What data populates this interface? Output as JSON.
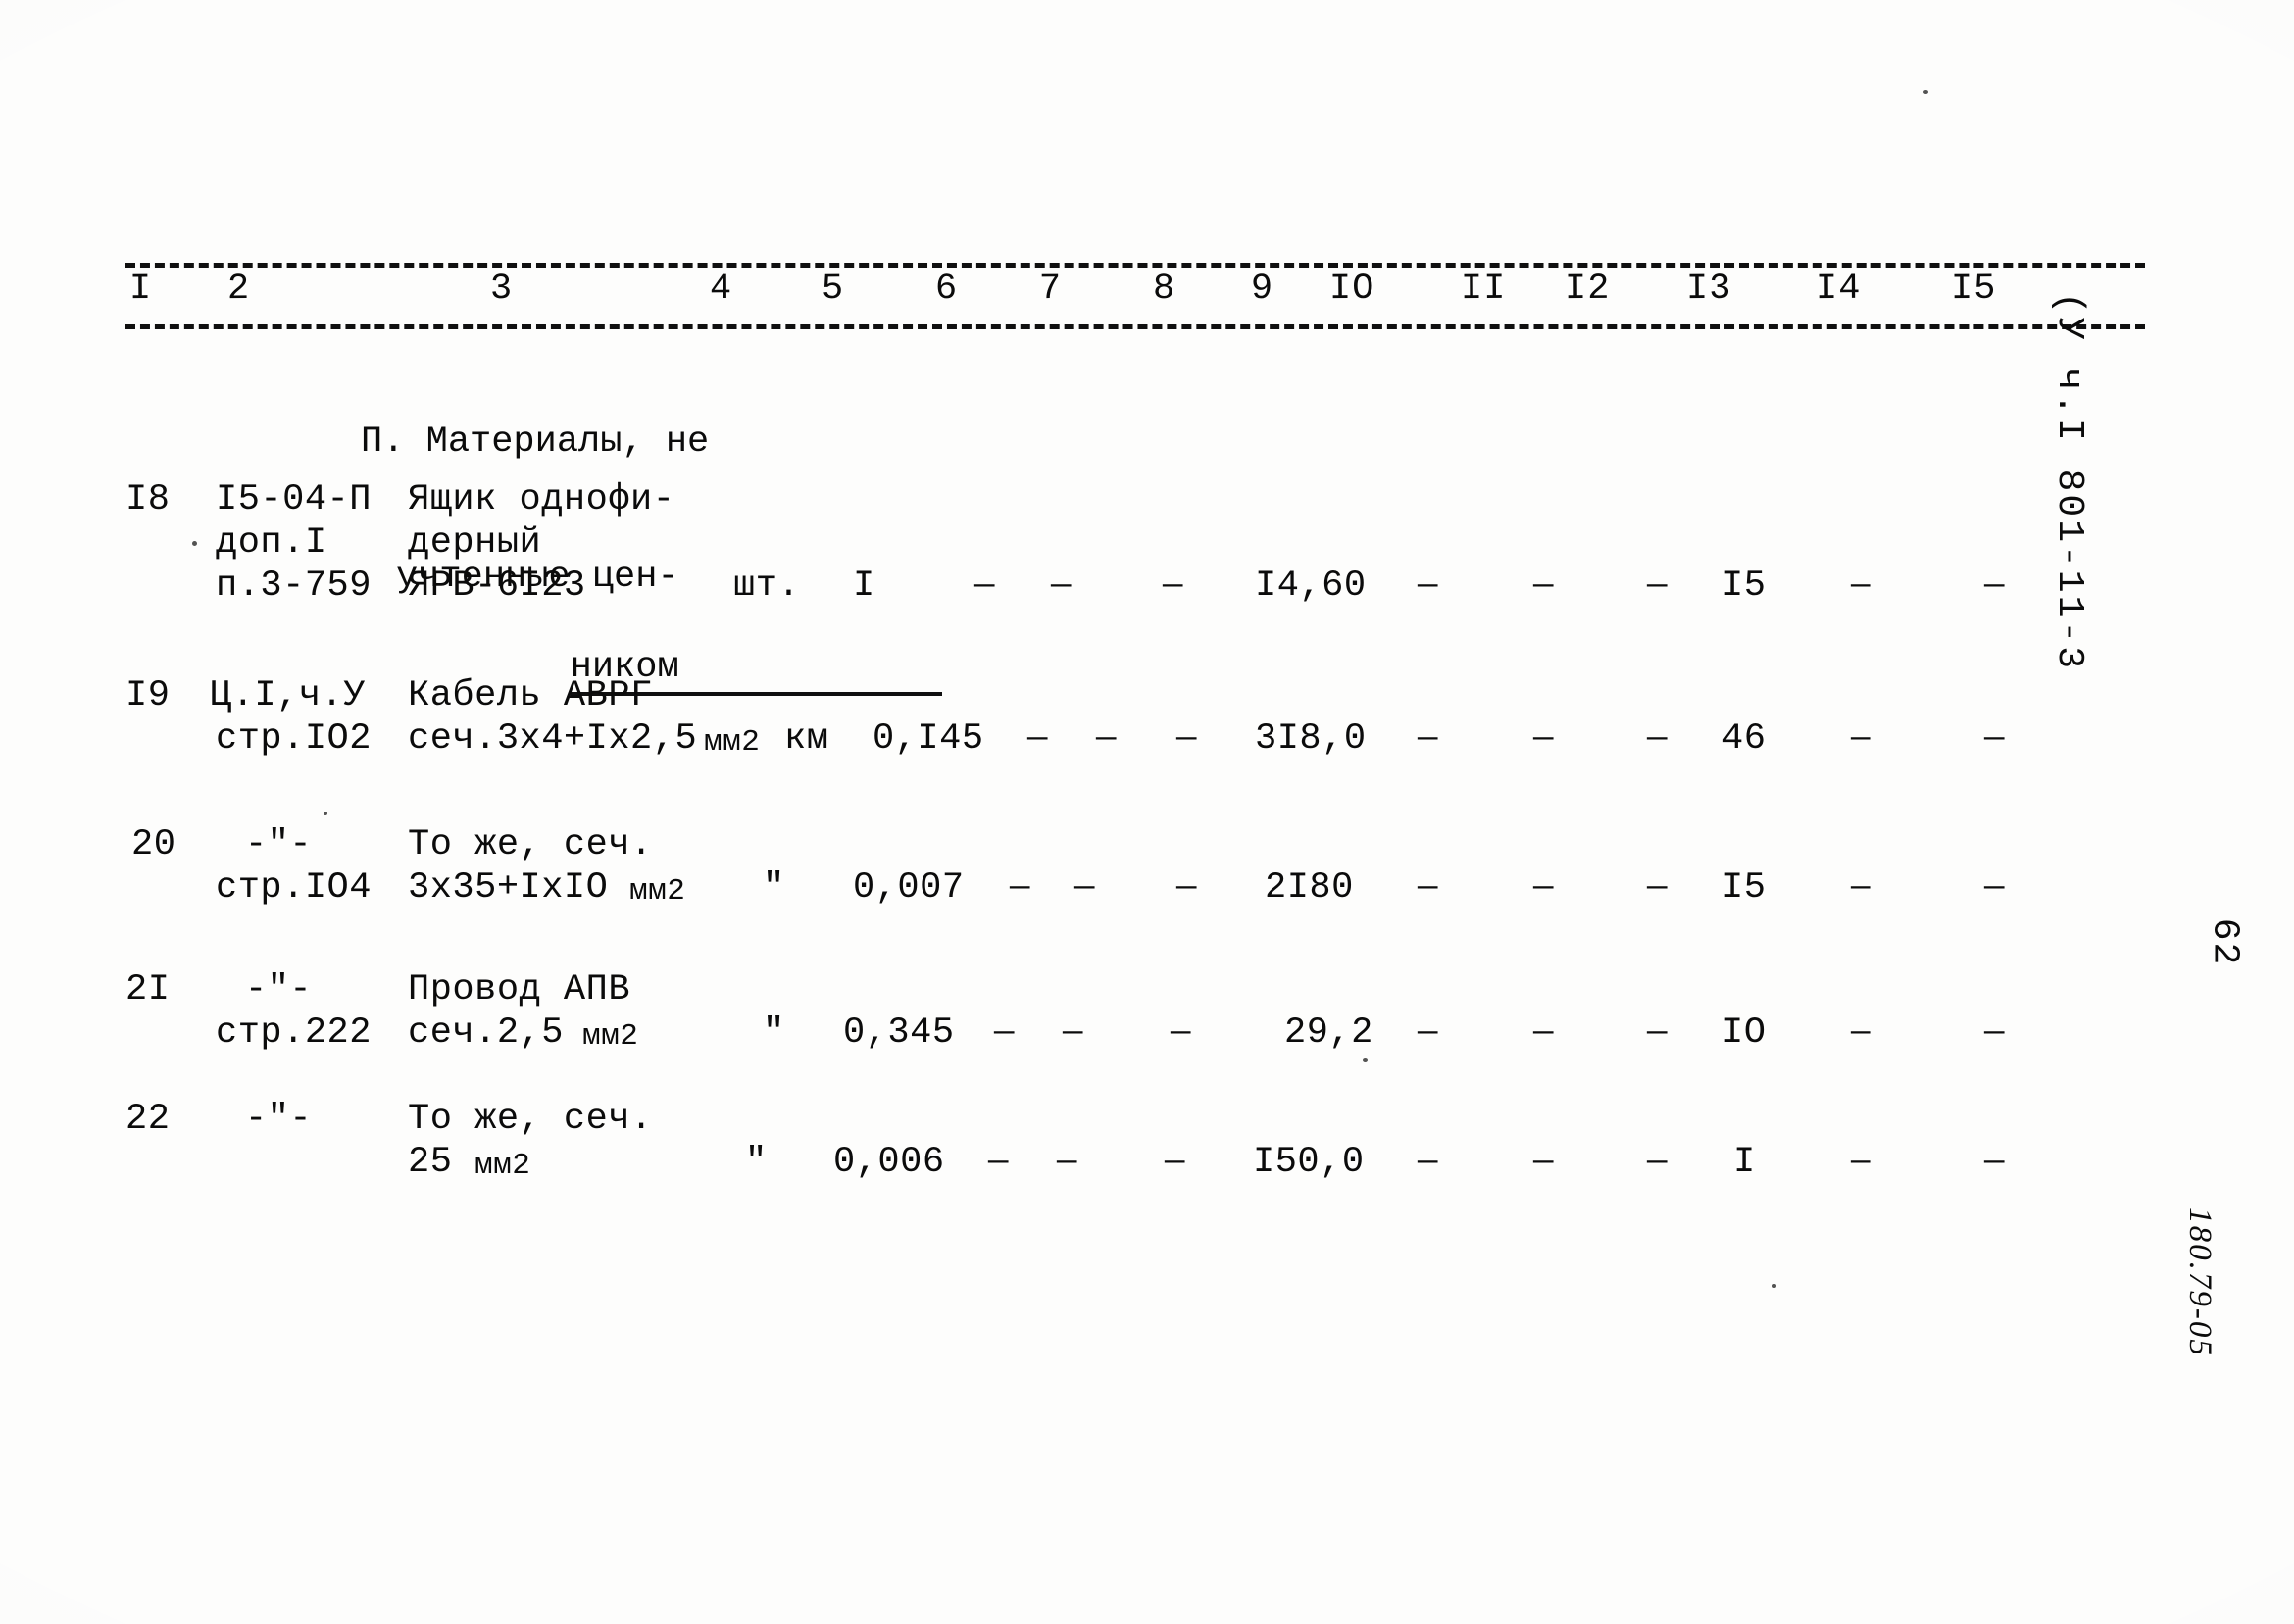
{
  "document": {
    "type": "scanned-estimate-table",
    "ink_color": "#0b0b0b",
    "paper_color": "#fdfdfc"
  },
  "column_headers": [
    "I",
    "2",
    "3",
    "4",
    "5",
    "6",
    "7",
    "8",
    "9",
    "IO",
    "II",
    "I2",
    "I3",
    "I4",
    "I5"
  ],
  "section": {
    "line1": "П. Материалы, не",
    "line2": "учтенные цен-",
    "line3": "ником"
  },
  "rows": [
    {
      "num": "I8",
      "code_line1": "I5-04-П",
      "code_line2": "доп.I",
      "code_line3": "п.3-759",
      "name_line1": "Ящик однофи-",
      "name_line2": "дерный",
      "name_line3": "ЯРВ-6I23",
      "unit": "шт.",
      "qty": "I",
      "c6": "—",
      "c7": "—",
      "c8": "—",
      "price": "I4,60",
      "c10": "—",
      "c11": "—",
      "c12": "—",
      "c13": "I5",
      "c14": "—",
      "c15": "—"
    },
    {
      "num": "I9",
      "code_line1": "Ц.I,ч.У",
      "code_line2": "стр.IO2",
      "code_line3": "",
      "name_line1": "Кабель АВРГ",
      "name_line2": "сеч.3х4+Iх2,5",
      "name_line2_sub": "мм2",
      "name_line3": "",
      "unit": "км",
      "qty": "0,I45",
      "c6": "—",
      "c7": "—",
      "c8": "—",
      "price": "3I8,0",
      "c10": "—",
      "c11": "—",
      "c12": "—",
      "c13": "46",
      "c14": "—",
      "c15": "—"
    },
    {
      "num": "20",
      "code_line1": "-\"-",
      "code_line2": "стр.IO4",
      "code_line3": "",
      "name_line1": "То же, сеч.",
      "name_line2": "3х35+IхIO",
      "name_line2_sub": "мм2",
      "name_line3": "",
      "unit": "\"",
      "qty": "0,007",
      "c6": "—",
      "c7": "—",
      "c8": "—",
      "price": "2I80",
      "c10": "—",
      "c11": "—",
      "c12": "—",
      "c13": "I5",
      "c14": "—",
      "c15": "—"
    },
    {
      "num": "2I",
      "code_line1": "-\"-",
      "code_line2": "стр.222",
      "code_line3": "",
      "name_line1": "Провод АПВ",
      "name_line2": "сеч.2,5",
      "name_line2_sub": "мм2",
      "name_line3": "",
      "unit": "\"",
      "qty": "0,345",
      "c6": "—",
      "c7": "—",
      "c8": "—",
      "price": "29,2",
      "c10": "—",
      "c11": "—",
      "c12": "—",
      "c13": "IO",
      "c14": "—",
      "c15": "—"
    },
    {
      "num": "22",
      "code_line1": "-\"-",
      "code_line2": "",
      "code_line3": "",
      "name_line1": "То же, сеч.",
      "name_line2": "25",
      "name_line2_sub": "мм2",
      "name_line3": "",
      "unit": "\"",
      "qty": "0,006",
      "c6": "—",
      "c7": "—",
      "c8": "—",
      "price": "I50,0",
      "c10": "—",
      "c11": "—",
      "c12": "—",
      "c13": "I",
      "c14": "—",
      "c15": "—"
    }
  ],
  "margin": {
    "code": "(У ч.I  801-11-3",
    "page": "62",
    "stamp": "180.79-05"
  }
}
